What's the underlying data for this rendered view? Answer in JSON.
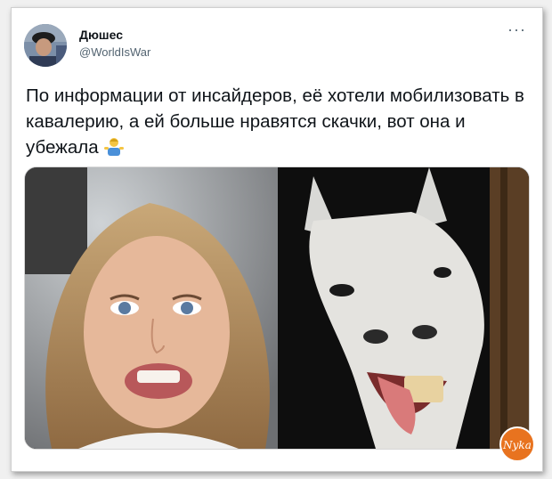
{
  "tweet": {
    "author_name": "Дюшес",
    "author_handle": "@WorldIsWar",
    "more_label": "···",
    "text": "По информации от инсайдеров, её хотели мобилизовать в кавалерию, а ей больше нравятся скачки, вот она и убежала",
    "emoji": "person-shrugging-emoji"
  },
  "media": {
    "left_image": "woman-smiling-photo",
    "right_image": "horse-laughing-photo"
  },
  "watermark": {
    "text": "Nyka"
  },
  "colors": {
    "name": "#0f1419",
    "handle": "#536471",
    "card_bg": "#ffffff",
    "page_bg": "#f0f0f0",
    "watermark": "#e8731f"
  }
}
